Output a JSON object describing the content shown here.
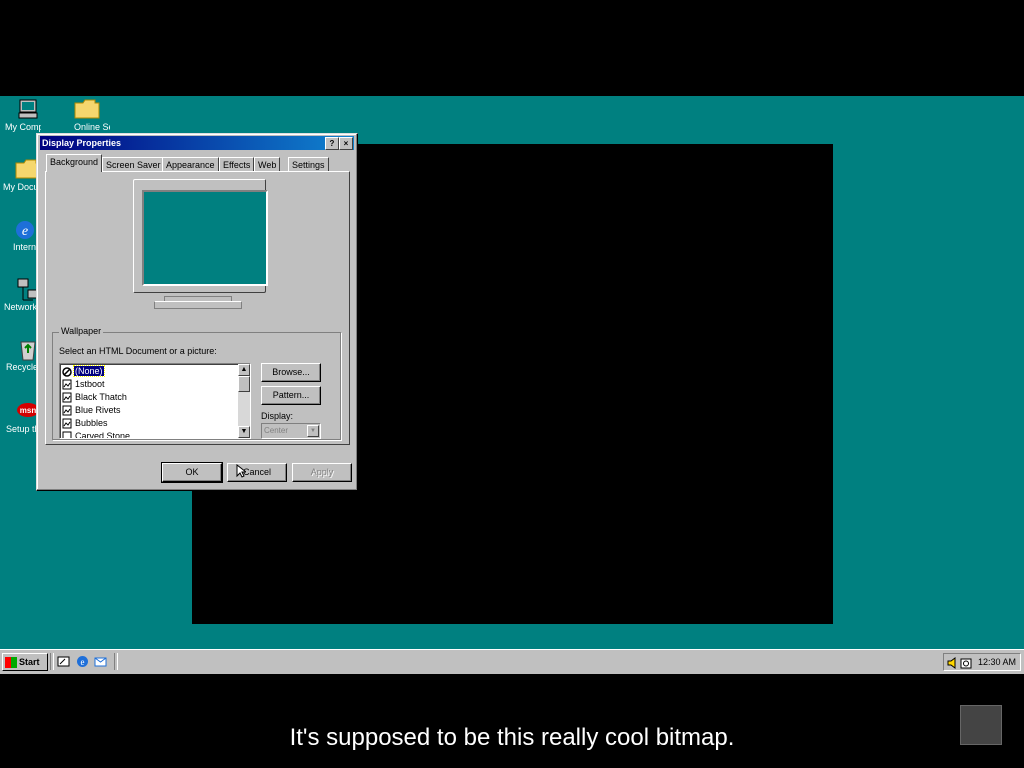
{
  "desktop_icons": [
    {
      "label": "My Computer",
      "icon": "my-computer-icon"
    },
    {
      "label": "Online Services",
      "icon": "folder-icon"
    },
    {
      "label": "My Documents",
      "icon": "folder-icon"
    },
    {
      "label": "Internet Explorer",
      "icon": "internet-explorer-icon"
    },
    {
      "label": "Network Neighborhood",
      "icon": "network-icon"
    },
    {
      "label": "Recycle Bin",
      "icon": "recycle-bin-icon"
    },
    {
      "label": "Setup the Internet",
      "icon": "msn-icon"
    }
  ],
  "dialog": {
    "title": "Display Properties",
    "help_button": "?",
    "close_button": "×",
    "tabs": [
      "Background",
      "Screen Saver",
      "Appearance",
      "Effects",
      "Web",
      "Settings"
    ],
    "active_tab": "Background",
    "wallpaper": {
      "group_label": "Wallpaper",
      "select_label": "Select an HTML Document or a picture:",
      "items": [
        "(None)",
        "1stboot",
        "Black Thatch",
        "Blue Rivets",
        "Bubbles",
        "Carved Stone"
      ],
      "selected": "(None)",
      "browse_button": "Browse...",
      "pattern_button": "Pattern...",
      "display_label": "Display:",
      "display_value": "Center"
    },
    "buttons": {
      "ok": "OK",
      "cancel": "Cancel",
      "apply": "Apply"
    }
  },
  "taskbar": {
    "start_label": "Start",
    "clock": "12:30 AM"
  },
  "colors": {
    "desktop": "#008080",
    "titlebar": "#000080",
    "face": "#c0c0c0"
  },
  "subtitle": "It's supposed to be this really cool bitmap."
}
